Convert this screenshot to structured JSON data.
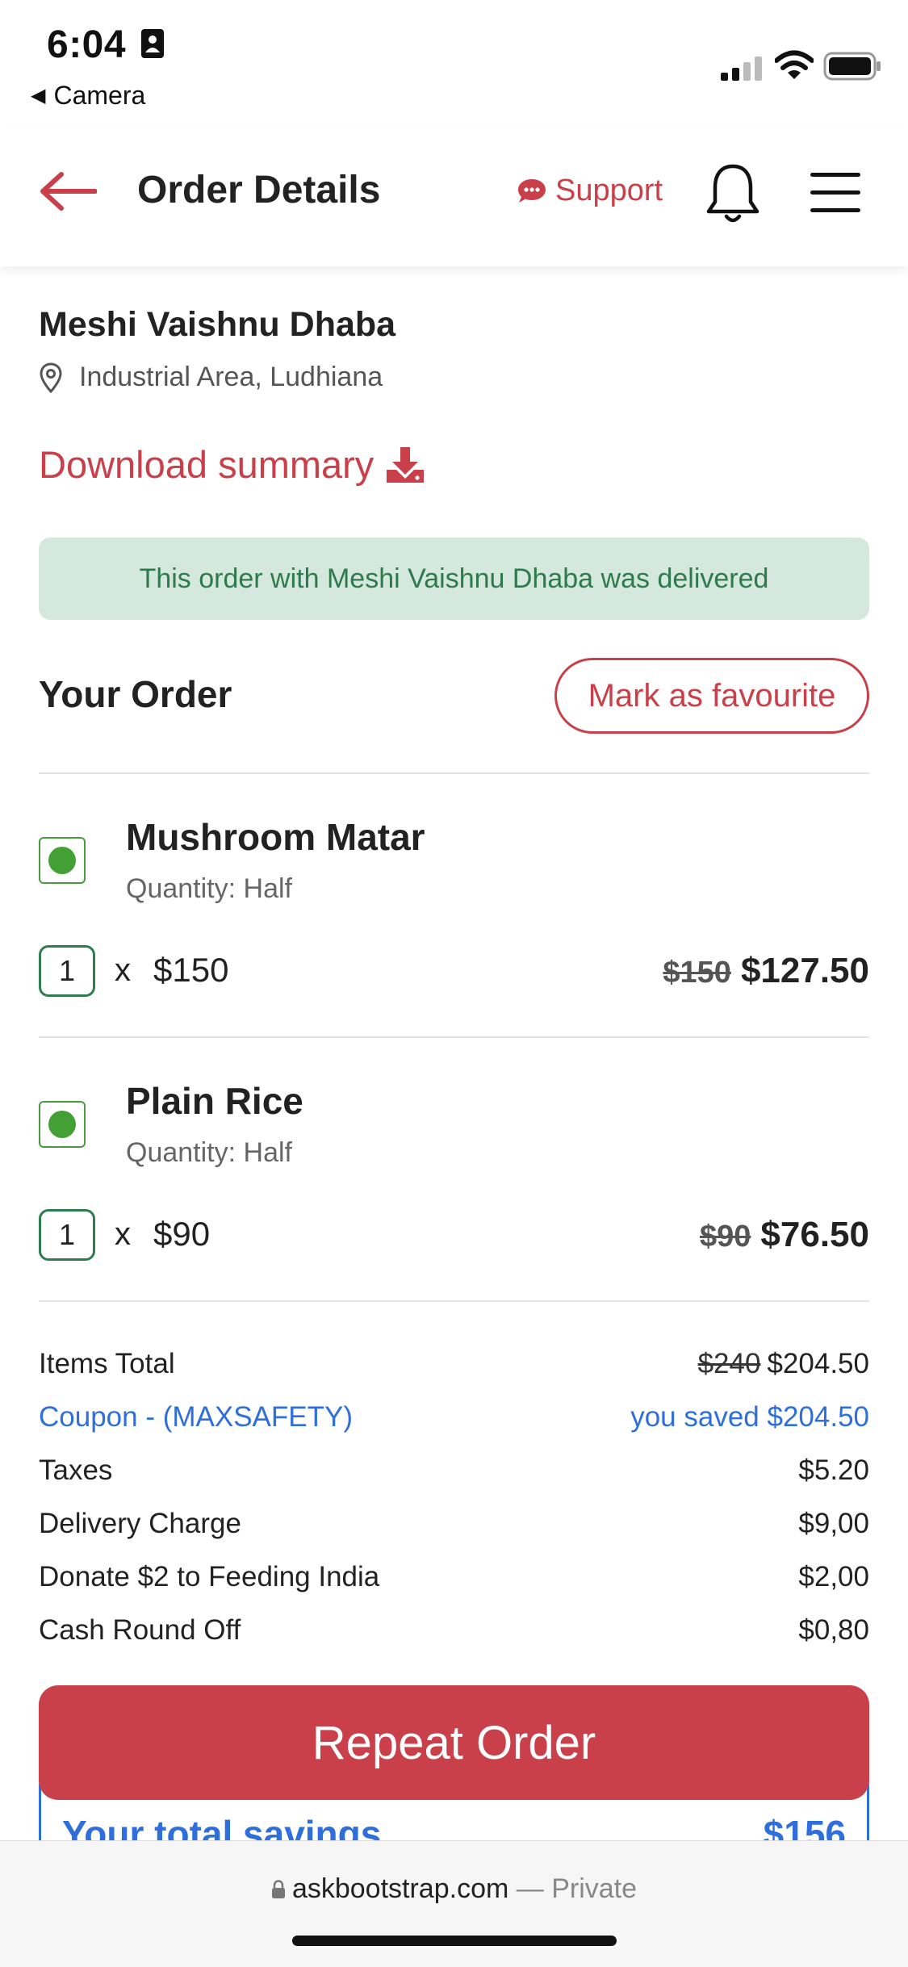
{
  "status_bar": {
    "time": "6:04",
    "back_app": "Camera"
  },
  "header": {
    "title": "Order Details",
    "support_label": "Support"
  },
  "restaurant": {
    "name": "Meshi Vaishnu Dhaba",
    "address": "Industrial Area, Ludhiana"
  },
  "download_label": "Download summary",
  "alert_text": "This order with Meshi Vaishnu Dhaba was delivered",
  "order": {
    "heading": "Your Order",
    "favourite_label": "Mark as favourite",
    "items": [
      {
        "name": "Mushroom Matar",
        "quantity": "Quantity: Half",
        "count": "1",
        "times": "x",
        "unit_price": "$150",
        "old_price": "$150",
        "price": "$127.50"
      },
      {
        "name": "Plain Rice",
        "quantity": "Quantity: Half",
        "count": "1",
        "times": "x",
        "unit_price": "$90",
        "old_price": "$90",
        "price": "$76.50"
      }
    ]
  },
  "summary": {
    "items_total": {
      "label": "Items Total",
      "old": "$240",
      "value": "$204.50"
    },
    "coupon": {
      "label": "Coupon - (MAXSAFETY)",
      "value": "you saved $204.50"
    },
    "taxes": {
      "label": "Taxes",
      "value": "$5.20"
    },
    "delivery": {
      "label": "Delivery Charge",
      "value": "$9,00"
    },
    "donate": {
      "label": "Donate $2 to Feeding India",
      "value": "$2,00"
    },
    "round_off": {
      "label": "Cash Round Off",
      "value": "$0,80"
    }
  },
  "repeat_label": "Repeat Order",
  "savings": {
    "label": "Your total savings",
    "value": "$156"
  },
  "browser": {
    "url": "askbootstrap.com",
    "mode": "— Private"
  },
  "colors": {
    "accent": "#c9404a",
    "blue": "#2f6fdb",
    "success_bg": "#d4e8de",
    "success_text": "#2f7a4d",
    "veg": "#43a034"
  }
}
